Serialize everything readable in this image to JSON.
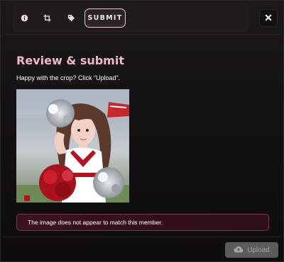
{
  "toolbar": {
    "steps": [
      {
        "id": "info",
        "icon": "info-icon"
      },
      {
        "id": "crop",
        "icon": "crop-icon"
      },
      {
        "id": "tag",
        "icon": "tag-icon"
      }
    ],
    "active_tab_label": "SUBMIT"
  },
  "dialog": {
    "close_icon": "close-icon",
    "title": "Review & submit",
    "subtitle": "Happy with the crop? Click “Upload”."
  },
  "preview": {
    "image_icon": "cropped-photo-preview",
    "watermark_icon": "corner-logo-icon"
  },
  "alert": {
    "message": "The image does not appear to match this member."
  },
  "footer": {
    "upload_label": "Upload",
    "upload_icon": "cloud-upload-icon"
  },
  "colors": {
    "accent": "#f0b9c7",
    "alert_border": "#7e3a4c",
    "alert_bg": "#3a121e",
    "button_disabled": "#5b5b5e"
  }
}
